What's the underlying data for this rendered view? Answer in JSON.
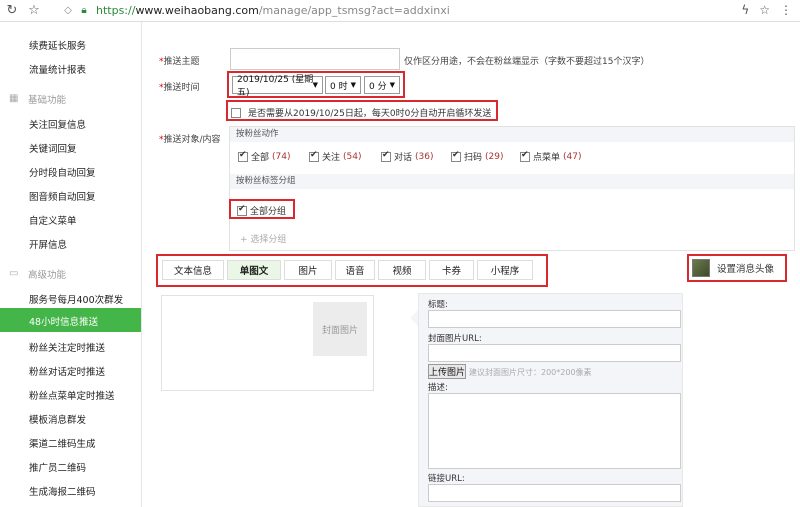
{
  "browser": {
    "url_scheme": "https://",
    "url_host": "www.weihaobang.com",
    "url_path": "/manage/app_tsmsg?act=addxinxi"
  },
  "sidebar": {
    "items_top": [
      "续费延长服务",
      "流量统计报表"
    ],
    "group_basic": "基础功能",
    "items_basic": [
      "关注回复信息",
      "关键词回复",
      "分时段自动回复",
      "图音频自动回复",
      "自定义菜单",
      "开屏信息"
    ],
    "group_advanced": "高级功能",
    "items_advanced": [
      "服务号每月400次群发",
      "48小时信息推送",
      "粉丝关注定时推送",
      "粉丝对话定时推送",
      "粉丝点菜单定时推送",
      "模板消息群发",
      "渠道二维码生成",
      "推广员二维码",
      "生成海报二维码"
    ],
    "active_item": "48小时信息推送"
  },
  "form": {
    "subject_label": "推送主题",
    "subject_hint": "仅作区分用途，不会在粉丝端显示（字数不要超过15个汉字）",
    "time_label": "推送时间",
    "date_value": "2019/10/25 (星期五)",
    "hour_value": "0 时",
    "minute_value": "0 分",
    "loop_text": "是否需要从2019/10/25日起，每天0时0分自动开启循环发送",
    "target_label": "推送对象/内容",
    "action_header": "按粉丝动作",
    "actions": [
      {
        "label": "全部",
        "count": "(74)"
      },
      {
        "label": "关注",
        "count": "(54)"
      },
      {
        "label": "对话",
        "count": "(36)"
      },
      {
        "label": "扫码",
        "count": "(29)"
      },
      {
        "label": "点菜单",
        "count": "(47)"
      }
    ],
    "tag_header": "按粉丝标签分组",
    "all_groups": "全部分组",
    "choose_group": "+ 选择分组"
  },
  "tabs": [
    "文本信息",
    "单图文",
    "图片",
    "语音",
    "视频",
    "卡券",
    "小程序"
  ],
  "active_tab": "单图文",
  "avatar_button": "设置消息头像",
  "editor": {
    "cover_placeholder": "封面图片",
    "title_label": "标题:",
    "cover_url_label": "封面图片URL:",
    "upload_button": "上传图片",
    "upload_hint": "建议封面图片尺寸：200*200像素",
    "desc_label": "描述:",
    "link_label": "链接URL:"
  },
  "colors": {
    "accent_green": "#44b549",
    "highlight_red": "#d9292e"
  }
}
